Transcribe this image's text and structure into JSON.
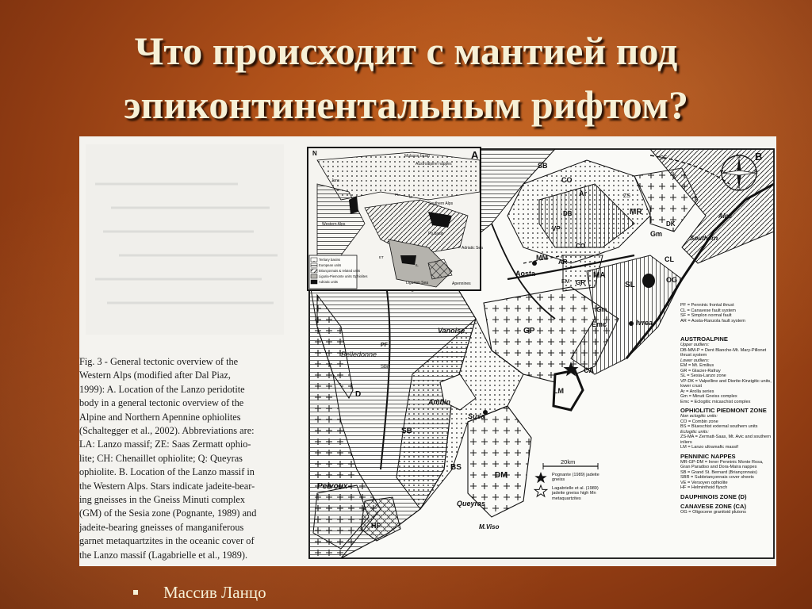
{
  "slide": {
    "title_line1": "Что происходит с мантией под",
    "title_line2": "эпиконтинентальным рифтом?",
    "bullet": "Массив Ланцо"
  },
  "figure": {
    "caption_lines": [
      "Fig. 3 - General tectonic overview of the",
      "Western Alps (modified after Dal Piaz,",
      "1999): A. Location of the Lanzo peridotite",
      "body in a general tectonic overview of the",
      "Alpine and Northern Apennine ophiolites",
      "(Schaltegger et al., 2002). Abbreviations are:",
      "LA: Lanzo massif; ZE: Saas Zermatt ophio-",
      "lite; CH: Chenaillet ophiolite; Q: Queyras",
      "ophiolite. B. Location of the Lanzo massif in",
      "the Western Alps. Stars indicate jadeite-bear-",
      "ing gneisses in the Gneiss Minuti complex",
      "(GM) of the Sesia zone (Pognante, 1989) and",
      "jadeite-bearing gneisses of manganiferous",
      "garnet metaquartzites in the oceanic cover of",
      "the Lanzo massif (Lagabrielle et al., 1989)."
    ],
    "panel_a": {
      "letter": "A",
      "north": "N",
      "labels": [
        "Molasse basin",
        "Austroalpine nappes",
        "Jura",
        "Southern Alps",
        "Western Alps",
        "Po basin",
        "Adriatic Sea",
        "Ligurian Sea",
        "Apennines",
        "ET",
        "PL",
        "M",
        "IL"
      ],
      "legend": [
        "Tertiary basins",
        "European units",
        "Briançonnais & related units",
        "Liguria-Piemonte units Ophiolites",
        "Adriatic units"
      ]
    },
    "panel_b": {
      "letter": "B",
      "compass": [
        "N",
        "S",
        "W",
        "E"
      ],
      "labels": [
        "SB",
        "CO",
        "Ar",
        "ZS",
        "MR",
        "DB",
        "VP",
        "Gm",
        "DK",
        "CL",
        "Southern",
        "Alps",
        "SF",
        "A",
        "MM",
        "AR",
        "CO",
        "Aosta",
        "MA",
        "EM",
        "GR",
        "SL",
        "OG",
        "Gm",
        "Emc",
        "Ivrea",
        "Vanoise",
        "GP",
        "CA",
        "LM",
        "Ambin",
        "Susa",
        "Belledonne",
        "PF",
        "SBr",
        "D",
        "SB",
        "Pelvoux",
        "BS",
        "DM",
        "Queyras",
        "HF",
        "M.Viso"
      ],
      "scale": "20km",
      "stars": [
        "Pognante (1989) jadeite gneiss",
        "Lagabrielle et al. (1989) jadeite gneiss high Mn metaquartzites"
      ],
      "faults": [
        "PF = Penninic frontal thrust",
        "CL = Canavese fault system",
        "SF = Simplon normal fault",
        "AR = Aosta-Ranzola fault system"
      ],
      "legend": [
        {
          "heading": "AUSTROALPINE",
          "items": [
            "Upper outliers:",
            "DB-MM-P = Dent Blanche-Mt. Mary-Pillonet thrust system",
            "Lower outliers:",
            "EM = Mt. Emilius",
            "GR = Glacier-Rafray",
            "SL = Sesia-Lanzo zone",
            "VP-DK = Valpelline and Diorite-Kinzigitic units, lower crust",
            "Ar = Arolla series",
            "Gm = Minuti Gneiss complex",
            "Emc = Eclogitic micaschist complex"
          ]
        },
        {
          "heading": "OPHIOLITIC PIEDMONT ZONE",
          "items": [
            "Non eclogitic units:",
            "CO = Combin zone",
            "BS = Blueschist external southern units",
            "Eclogitic units:",
            "ZS-MA = Zermatt-Saas, Mt. Avic and southern inliers",
            "LM = Lanzo ultramafic massif"
          ]
        },
        {
          "heading": "PENNINIC NAPPES",
          "items": [
            "MR-GP-DM = Inner Penninic Monte Rosa, Gran Paradiso and Dora-Maira nappes",
            "SB = Grand St. Bernard (Briançonnais)",
            "SBR = Subbriançonnais cover sheets",
            "VE = Versoyen ophiolite",
            "HF = Helminthoid flysch"
          ]
        },
        {
          "heading": "DAUPHINOIS ZONE (D)",
          "items": []
        },
        {
          "heading": "CANAVESE ZONE (CA)",
          "items": [
            "OG = Oligocene granitoid plutons"
          ]
        }
      ]
    }
  }
}
